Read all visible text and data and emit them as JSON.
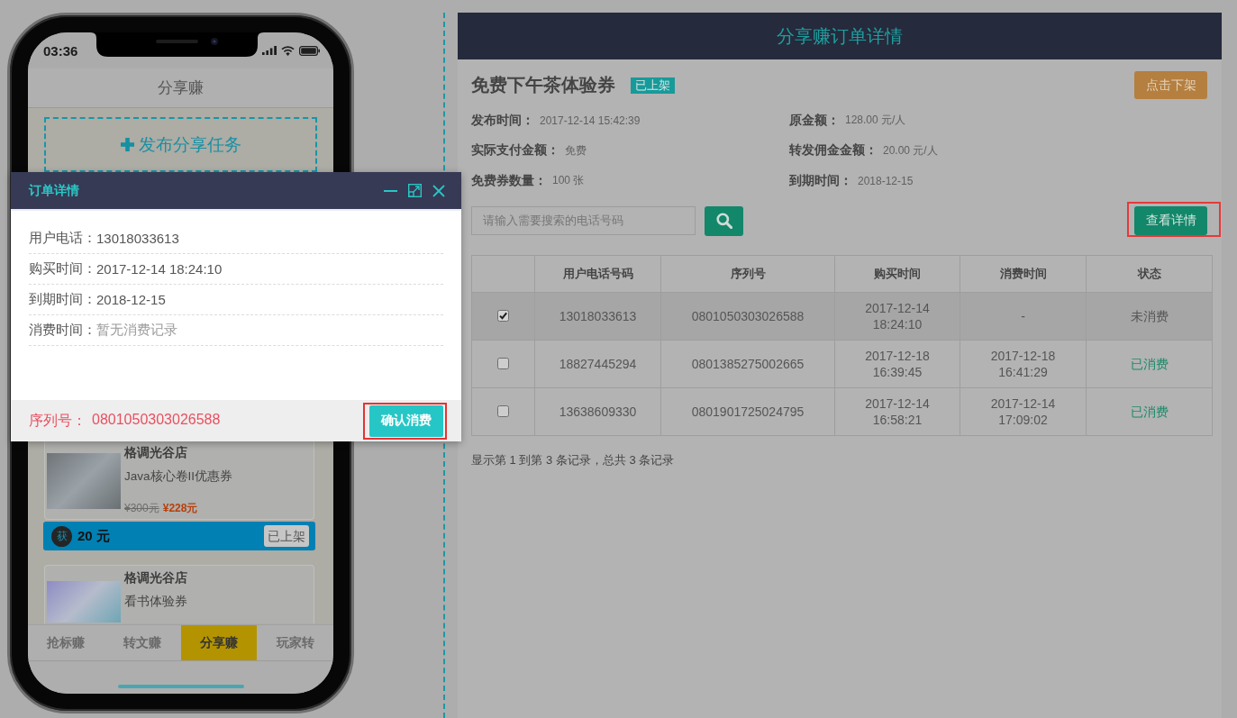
{
  "phone": {
    "status_bar": {
      "time": "03:36"
    },
    "nav_title": "分享赚",
    "publish_button": {
      "label": "发布分享任务"
    },
    "cards": [
      {
        "shop": "格调光谷店",
        "title": "Java核心卷II优惠券",
        "original_price": "¥300元",
        "price": "¥228元",
        "reward": {
          "icon_text": "获",
          "amount": "20 元",
          "badge": "已上架"
        }
      },
      {
        "shop": "格调光谷店",
        "title": "看书体验券"
      }
    ],
    "tabs": [
      {
        "label": "抢标赚",
        "selected": false
      },
      {
        "label": "转文赚",
        "selected": false
      },
      {
        "label": "分享赚",
        "selected": true
      },
      {
        "label": "玩家转",
        "selected": false
      }
    ]
  },
  "dialog": {
    "title": "订单详情",
    "fields": [
      {
        "label": "用户电话：",
        "value": "13018033613",
        "muted": false
      },
      {
        "label": "购买时间：",
        "value": "2017-12-14 18:24:10",
        "muted": false
      },
      {
        "label": "到期时间：",
        "value": "2018-12-15",
        "muted": false
      },
      {
        "label": "消费时间：",
        "value": "暂无消费记录",
        "muted": true
      }
    ],
    "footer": {
      "serial_label": "序列号：",
      "serial": "0801050303026588",
      "confirm_button": {
        "label": "确认消费",
        "highlighted": true
      }
    }
  },
  "panel": {
    "title": "分享赚订单详情",
    "product": {
      "name": "免费下午茶体验券",
      "badge": "已上架"
    },
    "delist_button": {
      "label": "点击下架"
    },
    "info": [
      {
        "label": "发布时间：",
        "value": "2017-12-14 15:42:39"
      },
      {
        "label": "原金额：",
        "value": "128.00 元/人"
      },
      {
        "label": "实际支付金额：",
        "value": "免费"
      },
      {
        "label": "转发佣金金额：",
        "value": "20.00 元/人"
      },
      {
        "label": "免费券数量：",
        "value": "100 张"
      },
      {
        "label": "到期时间：",
        "value": "2018-12-15"
      }
    ],
    "search": {
      "placeholder": "请输入需要搜索的电话号码"
    },
    "details_button": {
      "label": "查看详情",
      "highlighted": true
    },
    "table": {
      "columns": [
        "用户电话号码",
        "序列号",
        "购买时间",
        "消费时间",
        "状态"
      ],
      "rows": [
        {
          "selected": true,
          "checked": true,
          "cells": [
            "13018033613",
            "0801050303026588",
            "2017-12-14 18:24:10",
            "-"
          ],
          "status": "未消费",
          "consumed": false
        },
        {
          "selected": false,
          "checked": false,
          "cells": [
            "18827445294",
            "0801385275002665",
            "2017-12-18 16:39:45",
            "2017-12-18 16:41:29"
          ],
          "status": "已消费",
          "consumed": true
        },
        {
          "selected": false,
          "checked": false,
          "cells": [
            "13638609330",
            "0801901725024795",
            "2017-12-14 16:58:21",
            "2017-12-14 17:09:02"
          ],
          "status": "已消费",
          "consumed": true
        }
      ]
    },
    "summary": "显示第 1 到第 3 条记录，总共 3 条记录"
  }
}
